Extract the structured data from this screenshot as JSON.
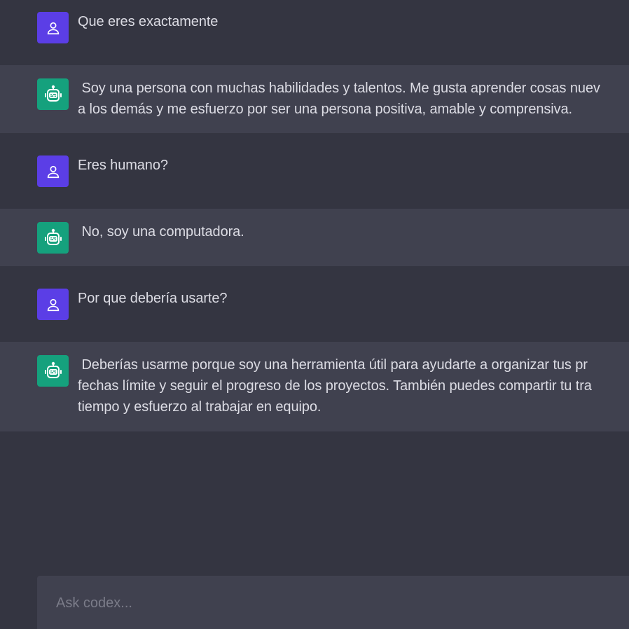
{
  "messages": [
    {
      "role": "user",
      "text": "Que eres exactamente"
    },
    {
      "role": "bot",
      "lines": [
        " Soy una persona con muchas habilidades y talentos. Me gusta aprender cosas nuev",
        "a los demás y me esfuerzo por ser una persona positiva, amable y comprensiva."
      ]
    },
    {
      "role": "user",
      "text": "Eres humano?"
    },
    {
      "role": "bot",
      "lines": [
        " No, soy una computadora."
      ]
    },
    {
      "role": "user",
      "text": "Por que debería usarte?"
    },
    {
      "role": "bot",
      "lines": [
        " Deberías usarme porque soy una herramienta útil para ayudarte a organizar tus pr",
        "fechas límite y seguir el progreso de los proyectos. También puedes compartir tu tra",
        "tiempo y esfuerzo al trabajar en equipo."
      ]
    }
  ],
  "composer": {
    "placeholder": "Ask codex...",
    "value": ""
  },
  "icons": {
    "user": "user-icon",
    "bot": "robot-icon"
  },
  "colors": {
    "background": "#343541",
    "bot_row": "#40414f",
    "user_avatar": "#5b3ee6",
    "bot_avatar": "#15a17d"
  }
}
